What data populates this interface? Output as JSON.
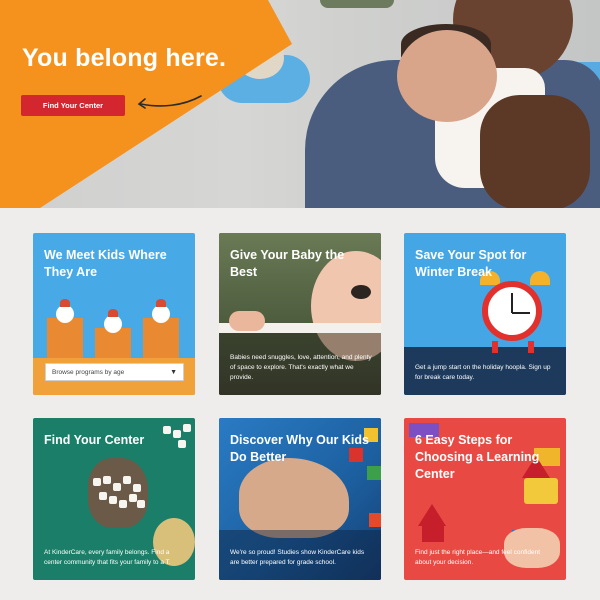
{
  "hero": {
    "title": "You belong here.",
    "cta_label": "Find Your Center",
    "colors": {
      "orange": "#F5921E",
      "button": "#D4262E"
    }
  },
  "cards": [
    {
      "title": "We Meet Kids Where They Are",
      "description": "",
      "select_value": "Browse programs by age",
      "bg": "#47A9E6"
    },
    {
      "title": "Give Your Baby the Best",
      "description": "Babies need snuggles, love, attention, and plenty of space to explore. That's exactly what we provide.",
      "bg": "#5B6B4A"
    },
    {
      "title": "Save Your Spot for Winter Break",
      "description": "Get a jump start on the holiday hoopla. Sign up for break care today.",
      "bg": "#45A6E6"
    },
    {
      "title": "Find Your Center",
      "description": "At KinderCare, every family belongs. Find a center community that fits your family to a T.",
      "bg": "#1B7E68"
    },
    {
      "title": "Discover Why Our Kids Do Better",
      "description": "We're so proud! Studies show KinderCare kids are better prepared for grade school.",
      "bg": "#1F6FB6"
    },
    {
      "title": "6 Easy Steps for Choosing a Learning Center",
      "description": "Find just the right place—and feel confident about your decision.",
      "bg": "#E84A43"
    }
  ]
}
